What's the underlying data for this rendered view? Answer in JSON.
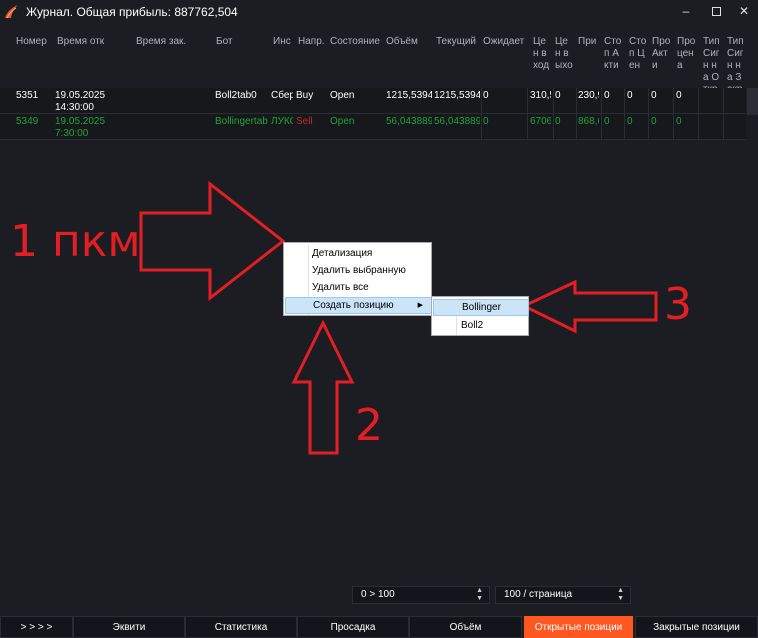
{
  "window": {
    "title": "Журнал.  Общая прибыль: 887762,504",
    "minimize": "–",
    "close": "✕"
  },
  "grid": {
    "columns": [
      "Номер",
      "Время отк",
      "Время зак.",
      "Бот",
      "Инс",
      "Напр.",
      "Состояние",
      "Объём",
      "Текущий",
      "Ожидает",
      "Цен вход",
      "Цен выхо",
      "При",
      "Стоп Акти",
      "Стоп Цен",
      "Про Акти",
      "Про цена",
      "Тип Сигн на Откр",
      "Тип Сигн на Закр"
    ],
    "rows": [
      [
        "5351",
        "19.05.2025 14:30:00",
        "",
        "Boll2tab0",
        "Сбер",
        "Buy",
        "Open",
        "1215,53941",
        "1215,53941",
        "0",
        "310,5",
        "0",
        "230,9",
        "0",
        "0",
        "0",
        "0",
        "",
        ""
      ],
      [
        "5349",
        "19.05.2025 7:30:00",
        "",
        "Bollingertab",
        "ЛУКС",
        "Sell",
        "Open",
        "56,0438896",
        "56,0438896",
        "0",
        "6706",
        "0",
        "868,6",
        "0",
        "0",
        "0",
        "0",
        "",
        ""
      ]
    ]
  },
  "context_menu": {
    "items": [
      "Детализация",
      "Удалить выбранную",
      "Удалить все",
      "Создать позицию"
    ],
    "arrow": "▶"
  },
  "submenu": {
    "items": [
      "Bollinger",
      "Boll2"
    ]
  },
  "annotations": {
    "label1": "1 пкм",
    "label2": "2",
    "label3": "3",
    "color": "#e31e24"
  },
  "pager": {
    "range": "0 > 100",
    "per_page": "100 / страница"
  },
  "tabs": [
    "> > > >",
    "Эквити",
    "Статистика",
    "Просадка",
    "Объём",
    "Открытые позиции",
    "Закрытые позиции"
  ],
  "colors": {
    "accent": "#ff5722",
    "buy_row": "#ffffff",
    "sell_row": "#22a33a",
    "sell_text": "#c22a2a"
  }
}
